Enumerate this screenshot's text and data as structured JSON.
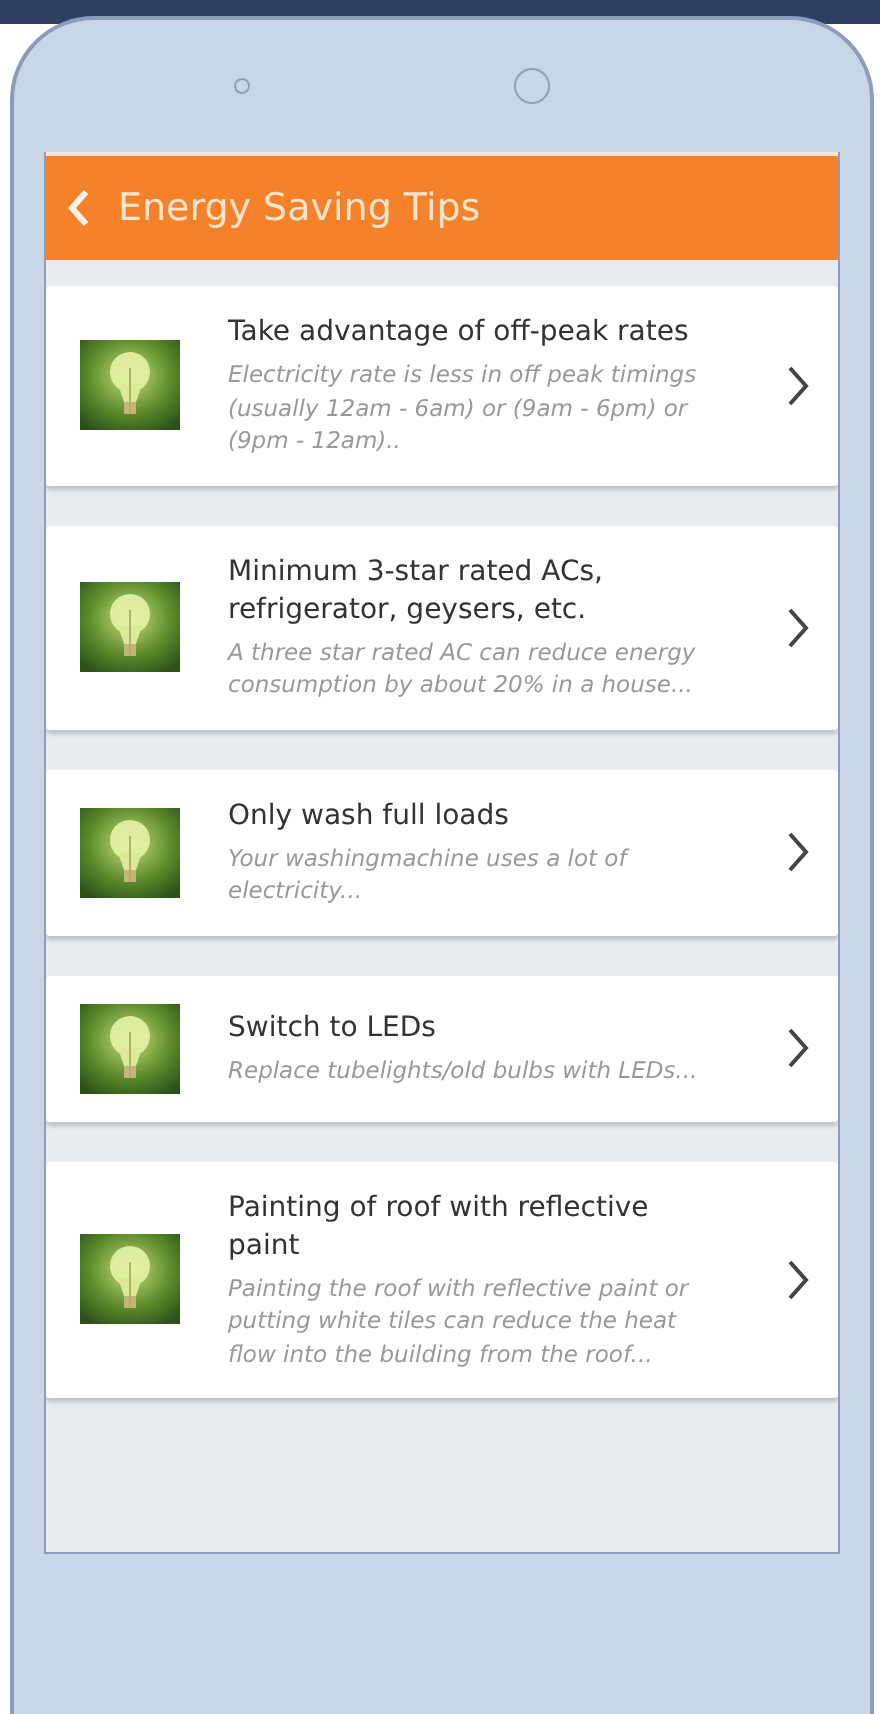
{
  "header": {
    "title": "Energy Saving Tips"
  },
  "tips": [
    {
      "title": "Take advantage of off-peak rates",
      "description": "Electricity rate is less in off peak timings (usually 12am - 6am) or (9am - 6pm) or (9pm - 12am).."
    },
    {
      "title": "Minimum 3-star rated ACs, refrigerator, geysers, etc.",
      "description": "A three star rated AC can reduce energy consumption by about 20% in a house..."
    },
    {
      "title": "Only wash full loads",
      "description": "Your washingmachine uses a lot of electricity..."
    },
    {
      "title": "Switch to LEDs",
      "description": "Replace tubelights/old bulbs with LEDs..."
    },
    {
      "title": "Painting of roof with reflective paint",
      "description": "Painting the roof with reflective paint or putting white tiles can reduce the heat flow into the building from the roof..."
    }
  ]
}
